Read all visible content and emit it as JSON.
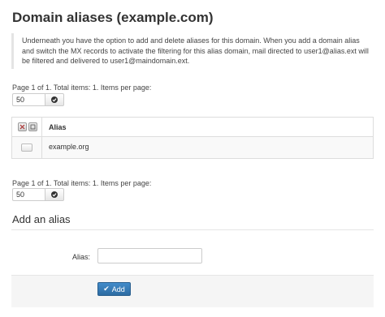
{
  "page": {
    "title": "Domain aliases (example.com)",
    "info": "Underneath you have the option to add and delete aliases for this domain. When you add a domain alias and switch the MX records to activate the filtering for this alias domain, mail directed to user1@alias.ext will be filtered and delivered to user1@maindomain.ext."
  },
  "pager_top": {
    "text": "Page 1 of 1. Total items: 1. Items per page:",
    "per_page_value": "50",
    "go_icon": "check-circle-icon"
  },
  "table": {
    "header_icons": [
      "select-all-icon",
      "deselect-all-icon"
    ],
    "column_alias": "Alias",
    "rows": [
      {
        "alias": "example.org"
      }
    ]
  },
  "pager_bottom": {
    "text": "Page 1 of 1. Total items: 1. Items per page:",
    "per_page_value": "50",
    "go_icon": "check-circle-icon"
  },
  "add_section": {
    "heading": "Add an alias",
    "alias_label": "Alias:",
    "alias_value": "",
    "add_button_icon": "check-icon",
    "add_button_label": "Add"
  },
  "colors": {
    "primary": "#428bca",
    "border": "#dddddd",
    "row_bg": "#f9f9f9",
    "actions_bg": "#f5f5f5"
  }
}
